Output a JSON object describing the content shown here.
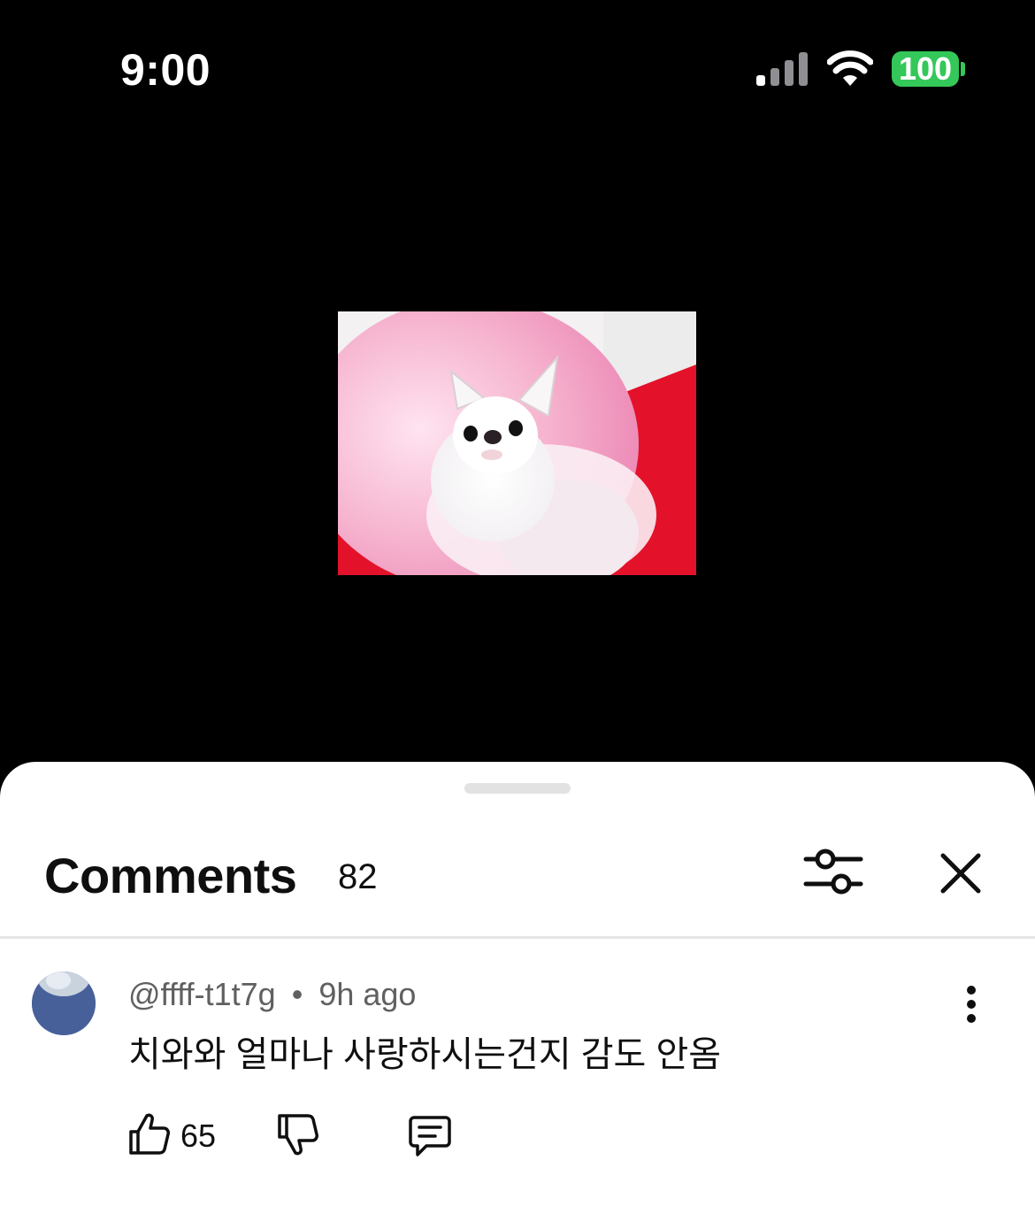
{
  "status_bar": {
    "time": "9:00",
    "battery": "100",
    "icons": [
      "signal-icon",
      "wifi-icon",
      "battery-icon"
    ]
  },
  "video": {
    "thumbnail": "white chihuahua on pink fluffy cushion"
  },
  "comments_panel": {
    "title": "Comments",
    "count": "82",
    "icons": [
      "filter-icon",
      "close-icon"
    ]
  },
  "comment": {
    "author": "@ffff-t1t7g",
    "separator": "•",
    "time_ago": "9h ago",
    "text": "치와와 얼마나 사랑하시는건지 감도 안옴",
    "like_count": "65",
    "icons": [
      "more-vertical-icon",
      "thumbs-up-icon",
      "thumbs-down-icon",
      "reply-icon"
    ]
  },
  "colors": {
    "battery": "#34c759",
    "text_primary": "#0f0f0f",
    "text_secondary": "#606060",
    "avatar": "#48609a"
  }
}
